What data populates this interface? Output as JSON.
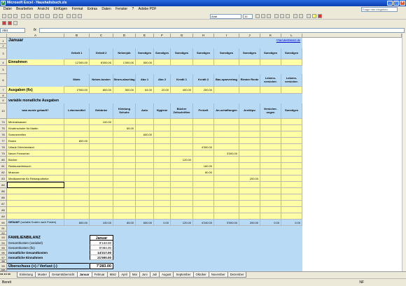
{
  "app": {
    "title": "Microsoft Excel - Haushaltsbuch.xls"
  },
  "menu": [
    "Datei",
    "Bearbeiten",
    "Ansicht",
    "Einfügen",
    "Format",
    "Extras",
    "Daten",
    "Fenster",
    "?",
    "Adobe PDF"
  ],
  "help_placeholder": "Frage hier eingeben",
  "font": {
    "name": "Arial",
    "size": "10"
  },
  "namebox": "A84",
  "fx": "fx",
  "columns": [
    "A",
    "B",
    "C",
    "D",
    "E",
    "F",
    "G",
    "H",
    "I",
    "J",
    "K",
    "L"
  ],
  "row_numbers": {
    "r1": "1",
    "r2": "2",
    "r3": "3",
    "r4": "4",
    "r5": "5",
    "r6": "6",
    "r7": "7",
    "r8": "8",
    "r9": "9",
    "r10": "10",
    "r74": "74",
    "r75": "75",
    "r76": "76",
    "r77": "77",
    "r78": "78",
    "r79": "79",
    "r80": "80",
    "r81": "81",
    "r82": "82",
    "r83": "83",
    "r84": "84",
    "r85": "85",
    "r86": "86",
    "r87": "87",
    "r88": "88",
    "r89": "89",
    "r90": "90",
    "r91": "91",
    "r92": "92",
    "r93": "93",
    "r94": "94",
    "r95": "95",
    "r96": "96",
    "r97": "97",
    "r98": "98",
    "r99": "99",
    "r100": "100"
  },
  "sheet": {
    "month": "Januar",
    "website": "©familienbilanz.de",
    "income_headers": [
      "Gehalt 1",
      "Gehalt 2",
      "Nebenjob",
      "Sonstiges",
      "Sonstiges",
      "Sonstiges",
      "Sonstiges",
      "Sonstiges",
      "Sonstiges",
      "Sonstiges",
      "Sonstiges"
    ],
    "income_label": "Einnahmen",
    "income_values": [
      "12'000.00",
      "8'000.00",
      "1'000.00",
      "500.00",
      "",
      "",
      "",
      "",
      "",
      "",
      ""
    ],
    "fixed_headers": [
      "Miete",
      "Neben-kosten",
      "Strom-abschlag",
      "Abo 1",
      "Abo 2",
      "Kredit 1",
      "Kredit 2",
      "Bau-sparvertrag",
      "Riester Rente",
      "Lebens-versicher.",
      "Lebens-versicher."
    ],
    "fixed_label": "Ausgaben (fix)",
    "fixed_values": [
      "2'900.00",
      "800.00",
      "500.00",
      "64.00",
      "20.00",
      "400.00",
      "200.00",
      "",
      "",
      "",
      ""
    ],
    "variable_title": "variable monatliche Ausgaben",
    "variable_headers": [
      "was wurde gekauft?",
      "Lebensmittel",
      "Getränke",
      "Kleidung Schuhe",
      "Auto",
      "Hygiene",
      "Bücher Zeitschriften",
      "Freizeit",
      "An-schaffungen",
      "Arzt/Apo",
      "Versicher-ungen",
      "Sonstiges"
    ],
    "rows": [
      {
        "item": "Mineralwasser",
        "values": [
          "",
          "100.00",
          "",
          "",
          "",
          "",
          "",
          "",
          "",
          "",
          ""
        ]
      },
      {
        "item": "Kinderschuhe für Martin",
        "values": [
          "",
          "",
          "65.00",
          "",
          "",
          "",
          "",
          "",
          "",
          "",
          ""
        ]
      },
      {
        "item": "Sommerreifen",
        "values": [
          "",
          "",
          "",
          "600.00",
          "",
          "",
          "",
          "",
          "",
          "",
          ""
        ]
      },
      {
        "item": "Essen",
        "values": [
          "800.00",
          "",
          "",
          "",
          "",
          "",
          "",
          "",
          "",
          "",
          ""
        ]
      },
      {
        "item": "Urlaub Griechenland",
        "values": [
          "",
          "",
          "",
          "",
          "",
          "",
          "4'000.00",
          "",
          "",
          "",
          ""
        ]
      },
      {
        "item": "Neuer Fernseher",
        "values": [
          "",
          "",
          "",
          "",
          "",
          "",
          "",
          "3'000.00",
          "",
          "",
          ""
        ]
      },
      {
        "item": "Bücher",
        "values": [
          "",
          "",
          "",
          "",
          "",
          "120.00",
          "",
          "",
          "",
          "",
          ""
        ]
      },
      {
        "item": "Restaurantbesuch",
        "values": [
          "",
          "",
          "",
          "",
          "",
          "",
          "160.00",
          "",
          "",
          "",
          ""
        ]
      },
      {
        "item": "Museum",
        "values": [
          "",
          "",
          "",
          "",
          "",
          "",
          "80.00",
          "",
          "",
          "",
          ""
        ]
      },
      {
        "item": "Medikamente für Reiseapotheke",
        "values": [
          "",
          "",
          "",
          "",
          "",
          "",
          "",
          "",
          "200.00",
          "",
          ""
        ]
      }
    ],
    "total_label": "GESAMT",
    "total_note": "(variable Kosten nach Posten)",
    "totals": [
      "800.00",
      "100.00",
      "65.00",
      "600.00",
      "0.00",
      "120.00",
      "4'240.00",
      "3'000.00",
      "200.00",
      "0.00",
      "0.00"
    ],
    "summary": {
      "title": "FAMILIENBILANZ",
      "month": "Januar",
      "rows": [
        {
          "label": "Gesamtkosten (variabel)",
          "value": "9'133.00",
          "bold": false
        },
        {
          "label": "Gesamtkosten (fix)",
          "value": "5'084.00",
          "bold": false
        },
        {
          "label": "monatliche Gesamtkosten",
          "value": "14'217.00",
          "bold": true
        },
        {
          "label": "monatliche Einnahmen",
          "value": "21'500.00",
          "bold": true
        }
      ],
      "result_label": "Überschuss (+) / Verlust (-)",
      "result_value": "7'283.00"
    }
  },
  "tabs": [
    "Einleitung",
    "Muster",
    "Gesamtübersicht",
    "Januar",
    "Februar",
    "März",
    "April",
    "Mai",
    "Juni",
    "Juli",
    "August",
    "September",
    "Oktober",
    "November",
    "Dezember"
  ],
  "active_tab": "Januar",
  "status": {
    "left": "Bereit",
    "right": "NF"
  }
}
